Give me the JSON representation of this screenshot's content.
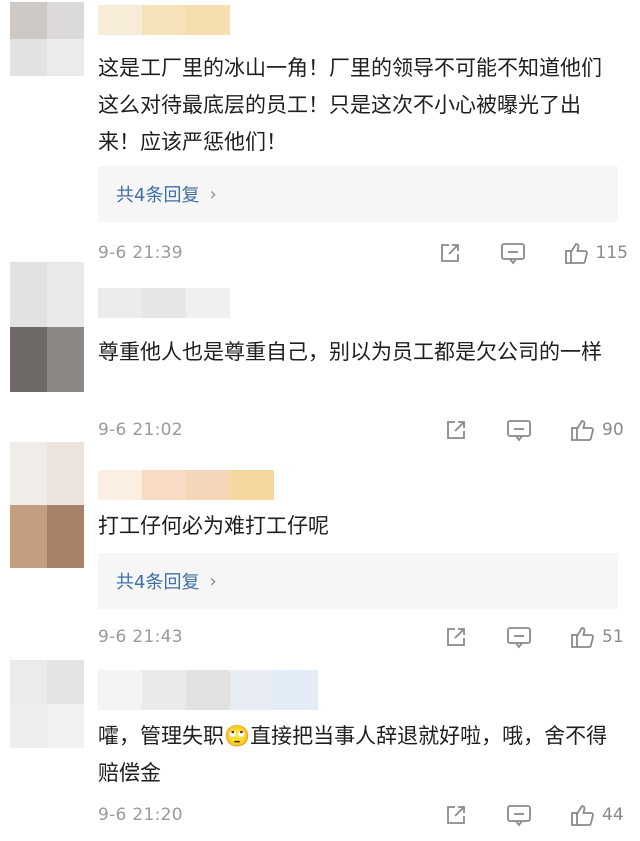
{
  "colors": {
    "link": "#3e6fa6",
    "meta": "#9a9a9a",
    "icon": "#8a8a8a",
    "reply_bg": "#f6f6f6"
  },
  "comments": [
    {
      "username_redacted": true,
      "text": "这是工厂里的冰山一角！厂里的领导不可能不知道他们这么对待最底层的员工！只是这次不小心被曝光了出来！应该严惩他们！",
      "reply_label": "共4条回复",
      "time": "9-6 21:39",
      "likes": "115",
      "icons": [
        "share-icon",
        "comment-icon",
        "like-icon"
      ]
    },
    {
      "username_redacted": true,
      "text": "尊重他人也是尊重自己，别以为员工都是欠公司的一样",
      "time": "9-6 21:02",
      "likes": "90",
      "icons": [
        "share-icon",
        "comment-icon",
        "like-icon"
      ]
    },
    {
      "username_redacted": true,
      "text": "打工仔何必为难打工仔呢",
      "reply_label": "共4条回复",
      "time": "9-6 21:43",
      "likes": "51",
      "icons": [
        "share-icon",
        "comment-icon",
        "like-icon"
      ]
    },
    {
      "username_redacted": true,
      "text": "嚯，管理失职🙄直接把当事人辞退就好啦，哦，舍不得赔偿金",
      "time": "9-6 21:20",
      "likes": "44",
      "icons": [
        "share-icon",
        "comment-icon",
        "like-icon"
      ]
    }
  ]
}
